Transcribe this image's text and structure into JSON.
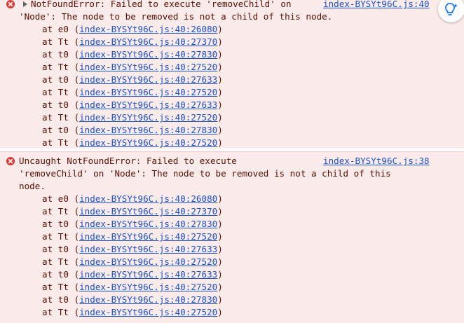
{
  "entry1": {
    "message_lines": [
      "NotFoundError: Failed to execute 'removeChild' on",
      "'Node': The node to be removed is not a child of this node."
    ],
    "source_link": "index-BYSYt96C.js:40",
    "stack": [
      {
        "fn": "at e0",
        "loc": "index-BYSYt96C.js:40:26080"
      },
      {
        "fn": "at Tt",
        "loc": "index-BYSYt96C.js:40:27370"
      },
      {
        "fn": "at t0",
        "loc": "index-BYSYt96C.js:40:27830"
      },
      {
        "fn": "at Tt",
        "loc": "index-BYSYt96C.js:40:27520"
      },
      {
        "fn": "at t0",
        "loc": "index-BYSYt96C.js:40:27633"
      },
      {
        "fn": "at Tt",
        "loc": "index-BYSYt96C.js:40:27520"
      },
      {
        "fn": "at t0",
        "loc": "index-BYSYt96C.js:40:27633"
      },
      {
        "fn": "at Tt",
        "loc": "index-BYSYt96C.js:40:27520"
      },
      {
        "fn": "at t0",
        "loc": "index-BYSYt96C.js:40:27830"
      },
      {
        "fn": "at Tt",
        "loc": "index-BYSYt96C.js:40:27520"
      }
    ]
  },
  "entry2": {
    "message_lines": [
      "Uncaught NotFoundError: Failed to execute",
      "'removeChild' on 'Node': The node to be removed is not a child of this",
      "node."
    ],
    "source_link": "index-BYSYt96C.js:38",
    "stack": [
      {
        "fn": "at e0",
        "loc": "index-BYSYt96C.js:40:26080"
      },
      {
        "fn": "at Tt",
        "loc": "index-BYSYt96C.js:40:27370"
      },
      {
        "fn": "at t0",
        "loc": "index-BYSYt96C.js:40:27830"
      },
      {
        "fn": "at Tt",
        "loc": "index-BYSYt96C.js:40:27520"
      },
      {
        "fn": "at t0",
        "loc": "index-BYSYt96C.js:40:27633"
      },
      {
        "fn": "at Tt",
        "loc": "index-BYSYt96C.js:40:27520"
      },
      {
        "fn": "at t0",
        "loc": "index-BYSYt96C.js:40:27633"
      },
      {
        "fn": "at Tt",
        "loc": "index-BYSYt96C.js:40:27520"
      },
      {
        "fn": "at t0",
        "loc": "index-BYSYt96C.js:40:27830"
      },
      {
        "fn": "at Tt",
        "loc": "index-BYSYt96C.js:40:27520"
      }
    ]
  },
  "icons": {
    "error": "error-circle-x-icon",
    "expand": "expand-triangle-icon",
    "ai_assist": "ai-assistance-icon"
  },
  "colors": {
    "error_bg": "#fcebeb",
    "error_text": "#5b0f00",
    "link": "#1a52c7",
    "error_icon": "#dc362e"
  }
}
